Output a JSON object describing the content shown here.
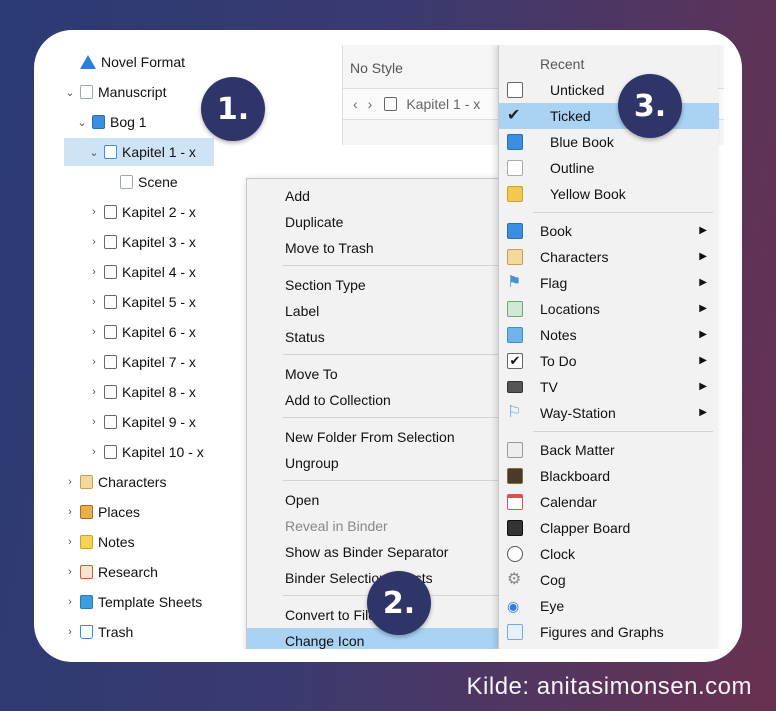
{
  "editor": {
    "style_label": "No Style",
    "breadcrumb": "Kapitel 1 - x"
  },
  "binder": {
    "items": [
      {
        "label": "Novel Format",
        "icon": "warning-icon"
      },
      {
        "label": "Manuscript",
        "icon": "document-icon"
      },
      {
        "label": "Bog 1",
        "icon": "book-icon"
      },
      {
        "label": "Kapitel 1 - x",
        "icon": "book-icon"
      },
      {
        "label": "Scene",
        "icon": "document-icon"
      },
      {
        "label": "Kapitel 2 - x",
        "icon": "checkbox-icon"
      },
      {
        "label": "Kapitel 3 - x",
        "icon": "checkbox-icon"
      },
      {
        "label": "Kapitel 4 -  x",
        "icon": "checkbox-icon"
      },
      {
        "label": "Kapitel 5 -  x",
        "icon": "checkbox-icon"
      },
      {
        "label": "Kapitel 6 - x",
        "icon": "checkbox-icon"
      },
      {
        "label": "Kapitel 7 - x",
        "icon": "checkbox-icon"
      },
      {
        "label": "Kapitel 8 - x",
        "icon": "checkbox-icon"
      },
      {
        "label": "Kapitel 9 - x",
        "icon": "checkbox-icon"
      },
      {
        "label": "Kapitel 10 - x",
        "icon": "checkbox-icon"
      },
      {
        "label": "Characters",
        "icon": "characters-icon"
      },
      {
        "label": "Places",
        "icon": "places-icon"
      },
      {
        "label": "Notes",
        "icon": "notes-icon"
      },
      {
        "label": "Research",
        "icon": "research-icon"
      },
      {
        "label": "Template Sheets",
        "icon": "template-icon"
      },
      {
        "label": "Trash",
        "icon": "trash-icon"
      }
    ]
  },
  "context_menu": {
    "items": [
      "Add",
      "Duplicate",
      "Move to Trash",
      "Section Type",
      "Label",
      "Status",
      "Move To",
      "Add to Collection",
      "New Folder From Selection",
      "Ungroup",
      "Open",
      "Reveal in Binder",
      "Show as Binder Separator",
      "Binder Selection Affects",
      "Convert to File",
      "Change Icon"
    ]
  },
  "icon_submenu": {
    "recent_heading": "Recent",
    "recent": [
      "Unticked",
      "Ticked",
      "Blue Book",
      "Outline",
      "Yellow Book"
    ],
    "categories": [
      "Book",
      "Characters",
      "Flag",
      "Locations",
      "Notes",
      "To Do",
      "TV",
      "Way-Station"
    ],
    "icons": [
      "Back Matter",
      "Blackboard",
      "Calendar",
      "Clapper Board",
      "Clock",
      "Cog",
      "Eye",
      "Figures and Graphs"
    ]
  },
  "badges": {
    "one": "1.",
    "two": "2.",
    "three": "3."
  },
  "credit": "Kilde: anitasimonsen.com",
  "colors": {
    "highlight": "#a9d2f3",
    "selection": "#cfe3f7",
    "badge": "#2f3568"
  }
}
